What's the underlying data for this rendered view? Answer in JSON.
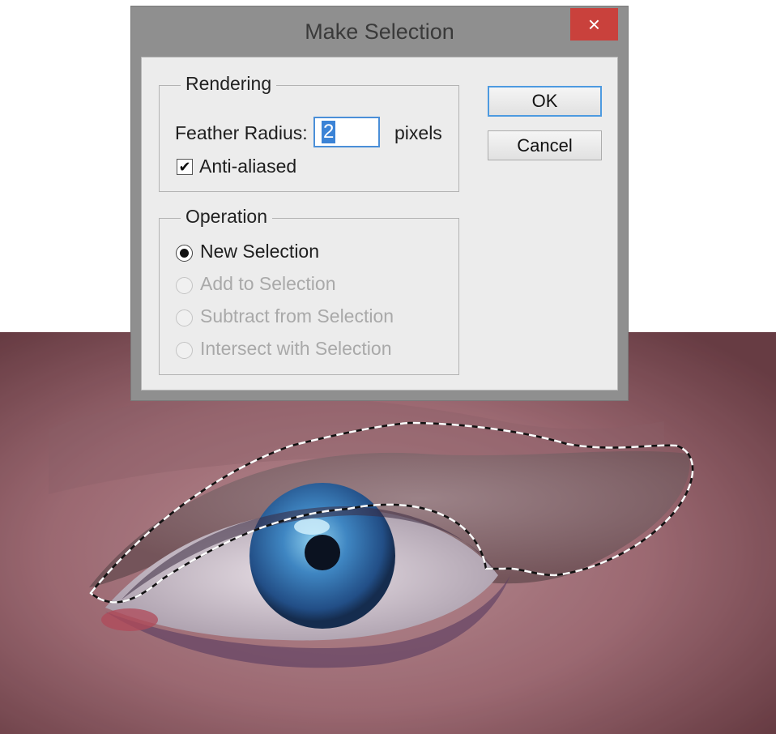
{
  "dialog": {
    "title": "Make Selection",
    "close_glyph": "×",
    "ok_label": "OK",
    "cancel_label": "Cancel"
  },
  "rendering": {
    "legend": "Rendering",
    "feather_label": "Feather Radius:",
    "feather_value": "2",
    "feather_unit": "pixels",
    "anti_alias_label": "Anti-aliased",
    "anti_alias_checked": true
  },
  "operation": {
    "legend": "Operation",
    "options": [
      {
        "label": "New Selection",
        "selected": true,
        "enabled": true
      },
      {
        "label": "Add to Selection",
        "selected": false,
        "enabled": false
      },
      {
        "label": "Subtract from Selection",
        "selected": false,
        "enabled": false
      },
      {
        "label": "Intersect with Selection",
        "selected": false,
        "enabled": false
      }
    ]
  },
  "colors": {
    "dialog_frame": "#8f8f8f",
    "close_button": "#c9413c",
    "client_bg": "#ececec",
    "accent_focus": "#4d9ae0",
    "iris": "#3f7fb8",
    "skin": "#b07a84"
  },
  "icons": {
    "close": "close-icon",
    "checkbox": "checkmark-icon",
    "radio": "radio-dot-icon"
  }
}
